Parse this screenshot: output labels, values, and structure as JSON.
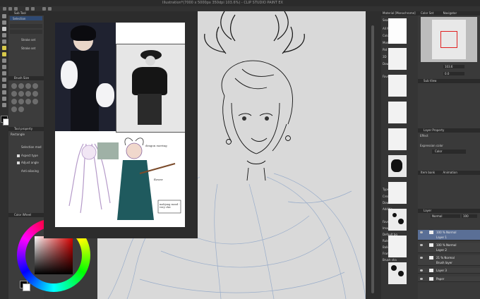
{
  "app": {
    "window_title": "Illustration*(7000 x 5000px 350dpi 103.6%) - CLIP STUDIO PAINT EX"
  },
  "tool_property": {
    "header": "Sub Tool",
    "tab_label": "Selection",
    "stroke_label": "Stroke set",
    "brush_size_header": "Brush Size",
    "tool_property_header": "Tool property",
    "tool_name": "Rectangle",
    "selection_mode_label": "Selection mod",
    "aspect_label": "Aspect type",
    "adjust_label": "Adjust angle",
    "antialias_label": "Anti-aliasing",
    "color_wheel_header": "Color Wheel"
  },
  "material_panel": {
    "header": "Material [Monochrome]",
    "search_label": "Search m",
    "folders": [
      "All Ma",
      "Colo",
      "Mon",
      "Pat",
      "3D",
      "Dow"
    ],
    "favorites_label": "Favori",
    "type_label": "Type",
    "type_items": [
      "Created",
      "Download",
      "Additio",
      "Favorites",
      "Image ma",
      "Default bg",
      "Ruler",
      "Balloon",
      "Framing te",
      "Brush sha"
    ]
  },
  "navigator": {
    "tab_label": "Color Set",
    "header": "Navigator",
    "zoom_value": "103.6",
    "angle_value": "0.0"
  },
  "sub_view": {
    "header": "Sub View"
  },
  "layer_property": {
    "header": "Layer Property",
    "effect_label": "Effect",
    "expression_label": "Expression color",
    "expression_value": "Color"
  },
  "item_bank": {
    "tab_label": "Item bank",
    "tab2_label": "Animation"
  },
  "layers_panel": {
    "header": "Layer",
    "blend_mode": "Normal",
    "opacity": "100",
    "layers": [
      {
        "name": "100 % Normal",
        "sub": "Layer 1",
        "selected": true
      },
      {
        "name": "100 % Normal",
        "sub": "Layer 2",
        "selected": false
      },
      {
        "name": "21 % Normal",
        "sub": "Brush layer",
        "selected": false
      },
      {
        "name": "Layer 3",
        "sub": "",
        "selected": false
      },
      {
        "name": "Paper",
        "sub": "",
        "selected": false
      }
    ]
  },
  "reference_notes": {
    "note1": "dragon earring",
    "note2": "flower",
    "note3": "mahjong mood - very chic"
  },
  "colors": {
    "main_color": "#000000",
    "sub_color": "#ffffff",
    "accent": "#5a6f96",
    "sketch_blue": "#8fa6c8"
  },
  "icons": [
    "pen-icon",
    "brush-icon",
    "eraser-icon",
    "fill-icon",
    "eye-icon",
    "folder-icon",
    "search-icon",
    "gear-icon"
  ]
}
